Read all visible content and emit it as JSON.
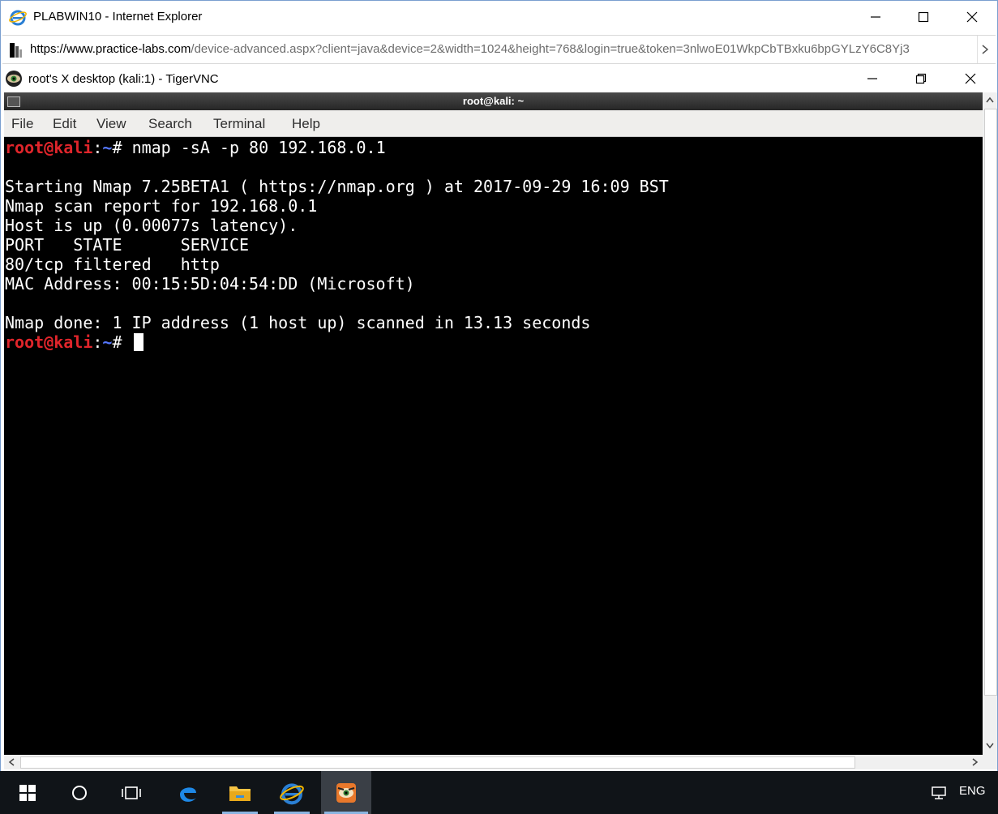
{
  "ie": {
    "title": "PLABWIN10 - Internet Explorer",
    "url_proto": "https://www.",
    "url_domain": "practice-labs.com",
    "url_rest": "/device-advanced.aspx?client=java&device=2&width=1024&height=768&login=true&token=3nlwoE01WkpCbTBxku6bpGYLzY6C8Yj3"
  },
  "vnc": {
    "title": "root's X desktop (kali:1) - TigerVNC"
  },
  "terminal": {
    "title": "root@kali: ~",
    "menu": [
      "File",
      "Edit",
      "View",
      "Search",
      "Terminal",
      "Help"
    ],
    "prompt_user": "root@kali",
    "prompt_sep": ":",
    "prompt_path": "~",
    "prompt_end": "# ",
    "command": "nmap -sA -p 80 192.168.0.1",
    "output": [
      "",
      "Starting Nmap 7.25BETA1 ( https://nmap.org ) at 2017-09-29 16:09 BST",
      "Nmap scan report for 192.168.0.1",
      "Host is up (0.00077s latency).",
      "PORT   STATE      SERVICE",
      "80/tcp filtered   http",
      "MAC Address: 00:15:5D:04:54:DD (Microsoft)",
      "",
      "Nmap done: 1 IP address (1 host up) scanned in 13.13 seconds"
    ]
  },
  "taskbar": {
    "items": [
      "start-icon",
      "cortana-icon",
      "task-view-icon",
      "edge-icon",
      "file-explorer-icon",
      "internet-explorer-icon",
      "tigervnc-icon"
    ],
    "language": "ENG"
  },
  "colors": {
    "prompt_user": "#e0252b",
    "prompt_path": "#5577ff",
    "terminal_bg": "#000000",
    "taskbar_bg": "#101418"
  }
}
